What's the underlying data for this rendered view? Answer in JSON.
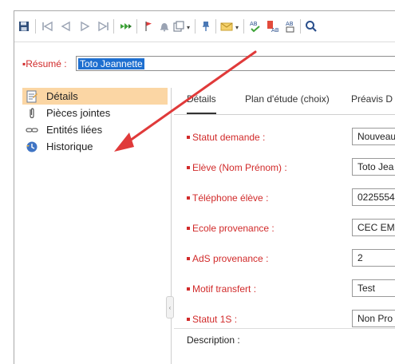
{
  "toolbar": {
    "icons": [
      "save-icon",
      "first-record-icon",
      "previous-record-icon",
      "next-record-icon",
      "last-record-icon",
      "go-to-icon",
      "flag-icon",
      "alert-icon",
      "copy-icon",
      "pin-icon",
      "mail-icon",
      "spelling-icon",
      "spelling-field-icon",
      "spelling-option-icon",
      "search-icon"
    ]
  },
  "resume": {
    "label": "Résumé :",
    "value": "Toto Jeannette"
  },
  "sidebar": {
    "items": [
      {
        "label": "Détails",
        "icon": "details-icon"
      },
      {
        "label": "Pièces jointes",
        "icon": "paperclip-icon"
      },
      {
        "label": "Entités liées",
        "icon": "link-icon"
      },
      {
        "label": "Historique",
        "icon": "history-icon"
      }
    ]
  },
  "tabs": [
    {
      "label": "Détails"
    },
    {
      "label": "Plan d'étude (choix)"
    },
    {
      "label": "Préavis D"
    }
  ],
  "fields": [
    {
      "label": "Statut demande :",
      "value": "Nouveau"
    },
    {
      "label": "Elève (Nom Prénom) :",
      "value": "Toto Jea"
    },
    {
      "label": "Téléphone élève :",
      "value": "0225554"
    },
    {
      "label": "Ecole provenance :",
      "value": "CEC EM"
    },
    {
      "label": "AdS provenance :",
      "value": "2"
    },
    {
      "label": "Motif transfert :",
      "value": "Test"
    },
    {
      "label": "Statut 1S :",
      "value": "Non Pro"
    }
  ],
  "description": {
    "label": "Description :"
  },
  "colors": {
    "accent_required": "#d12a2a",
    "selected_nav": "#fbd6a4",
    "annotation_arrow": "#e03a3a",
    "selection": "#1e6fd0"
  }
}
